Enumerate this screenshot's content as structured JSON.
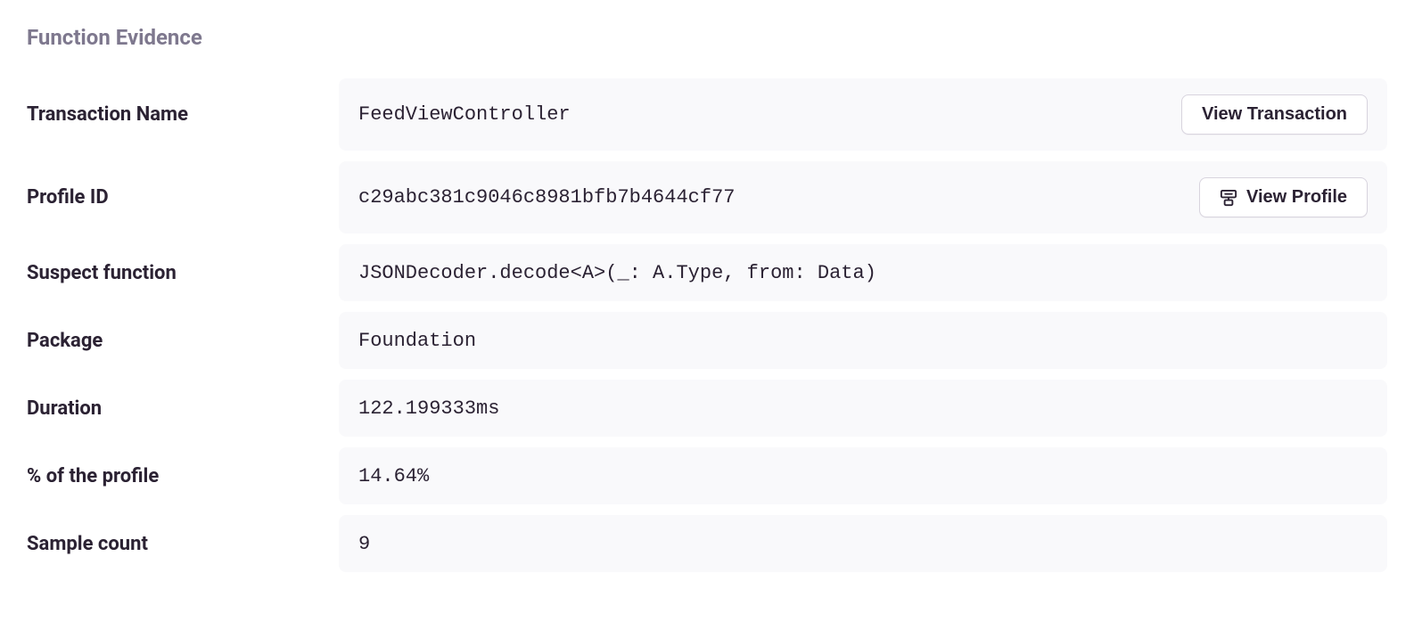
{
  "section": {
    "title": "Function Evidence"
  },
  "rows": {
    "transaction_name": {
      "label": "Transaction Name",
      "value": "FeedViewController",
      "button_label": "View Transaction"
    },
    "profile_id": {
      "label": "Profile ID",
      "value": "c29abc381c9046c8981bfb7b4644cf77",
      "button_label": "View Profile"
    },
    "suspect_function": {
      "label": "Suspect function",
      "value": "JSONDecoder.decode<A>(_: A.Type, from: Data)"
    },
    "package": {
      "label": "Package",
      "value": "Foundation"
    },
    "duration": {
      "label": "Duration",
      "value": "122.199333ms"
    },
    "percent_of_profile": {
      "label": "% of the profile",
      "value": "14.64%"
    },
    "sample_count": {
      "label": "Sample count",
      "value": "9"
    }
  }
}
